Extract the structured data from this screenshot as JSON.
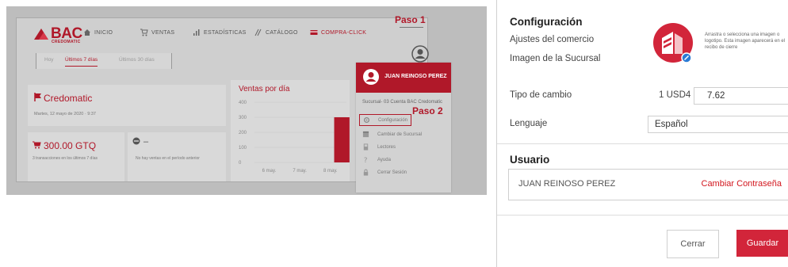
{
  "left": {
    "logo": {
      "text": "BAC",
      "sub": "CREDOMATIC"
    },
    "nav": [
      {
        "label": "INICIO",
        "icon": "home-icon"
      },
      {
        "label": "VENTAS",
        "icon": "cart-icon"
      },
      {
        "label": "ESTADÍSTICAS",
        "icon": "bar-chart-icon"
      },
      {
        "label": "CATÁLOGO",
        "icon": "tag-icon"
      },
      {
        "label": "COMPRA-CLICK",
        "icon": "card-icon"
      }
    ],
    "steps": {
      "paso1": "Paso 1",
      "paso2": "Paso 2"
    },
    "tabs": [
      "Hoy",
      "Últimos 7 días",
      "Últimos 30 días"
    ],
    "credomatic": {
      "title": "Credomatic",
      "date": "Martes, 12 mayo de 2020 · 9:37"
    },
    "amount": {
      "value": "300.00 GTQ",
      "sub": "3 transacciones en los últimos 7 días"
    },
    "no_sales": {
      "dash": "–",
      "sub": "No hay ventas en el período anterior"
    },
    "chart_data": {
      "type": "bar",
      "title": "Ventas por día",
      "categories": [
        "6 may.",
        "7 may.",
        "8 may."
      ],
      "values": [
        0,
        0,
        300
      ],
      "ylim": [
        0,
        400
      ],
      "yticks": [
        "0",
        "100",
        "200",
        "300",
        "400"
      ],
      "colors": {
        "bar": "#b01829"
      }
    },
    "dropdown": {
      "user": "JUAN REINOSO PEREZ",
      "branch": "Sucursal- 03 Cuenta BAC Credomatic",
      "items": [
        {
          "label": "Configuración",
          "icon": "gear-icon"
        },
        {
          "label": "Cambiar de Sucursal",
          "icon": "store-icon"
        },
        {
          "label": "Lectores",
          "icon": "reader-icon"
        },
        {
          "label": "Ayuda",
          "icon": "help-icon"
        },
        {
          "label": "Cerrar Sesión",
          "icon": "lock-icon"
        }
      ]
    }
  },
  "right": {
    "title": "Configuración",
    "subtitle": "Ajustes del comercio",
    "image_label": "Imagen de la Sucursal",
    "upload_hint": "Arrastra o selecciona una imagen o logotipo. Esta imagen aparecerá en el recibo de cierre",
    "exchange_label": "Tipo de cambio",
    "exchange_prefix": "1 USD4",
    "exchange_value": "7.62",
    "language_label": "Lenguaje",
    "language_value": "Español",
    "user_heading": "Usuario",
    "user_name": "JUAN REINOSO PEREZ",
    "change_password": "Cambiar Contraseña",
    "close_button": "Cerrar",
    "save_button": "Guardar",
    "colors": {
      "accent": "#d2253a",
      "brand": "#b01829"
    }
  }
}
